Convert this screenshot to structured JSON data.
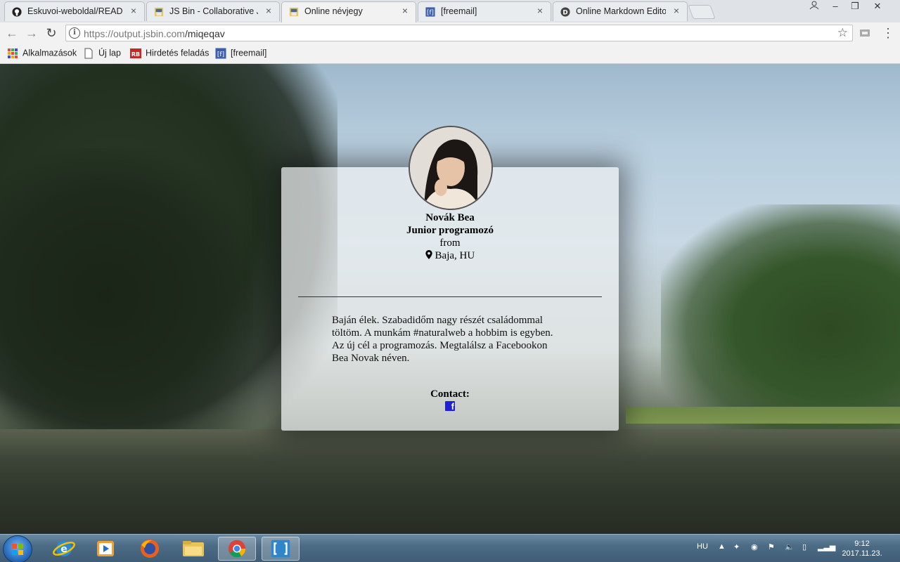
{
  "browser": {
    "tabs": [
      {
        "title": "Eskuvoi-weboldal/READM",
        "icon": "github-icon"
      },
      {
        "title": "JS Bin - Collaborative Jav",
        "icon": "jsbin-icon"
      },
      {
        "title": "Online névjegy",
        "icon": "jsbin-icon",
        "active": true
      },
      {
        "title": "[freemail]",
        "icon": "freemail-icon"
      },
      {
        "title": "Online Markdown Editor",
        "icon": "dillinger-icon"
      }
    ],
    "url_host": "https://output.jsbin.com",
    "url_path": "/miqeqav",
    "bookmarks": [
      {
        "label": "Alkalmazások",
        "icon": "apps-grid-icon"
      },
      {
        "label": "Új lap",
        "icon": "page-icon"
      },
      {
        "label": "Hirdetés feladás",
        "icon": "rb-icon"
      },
      {
        "label": "[freemail]",
        "icon": "freemail-icon"
      }
    ]
  },
  "card": {
    "name": "Novák Bea",
    "role": "Junior programozó",
    "from_label": "from",
    "location": "Baja, HU",
    "bio": "Baján élek. Szabadidőm nagy részét családommal töltöm. A munkám #naturalweb a hobbim is egyben. Az új cél a programozás. Megtalálsz a Facebookon Bea Novak néven.",
    "contact_label": "Contact:",
    "contact_icon": "facebook-icon"
  },
  "taskbar": {
    "language": "HU",
    "time": "9:12",
    "date": "2017.11.23."
  }
}
